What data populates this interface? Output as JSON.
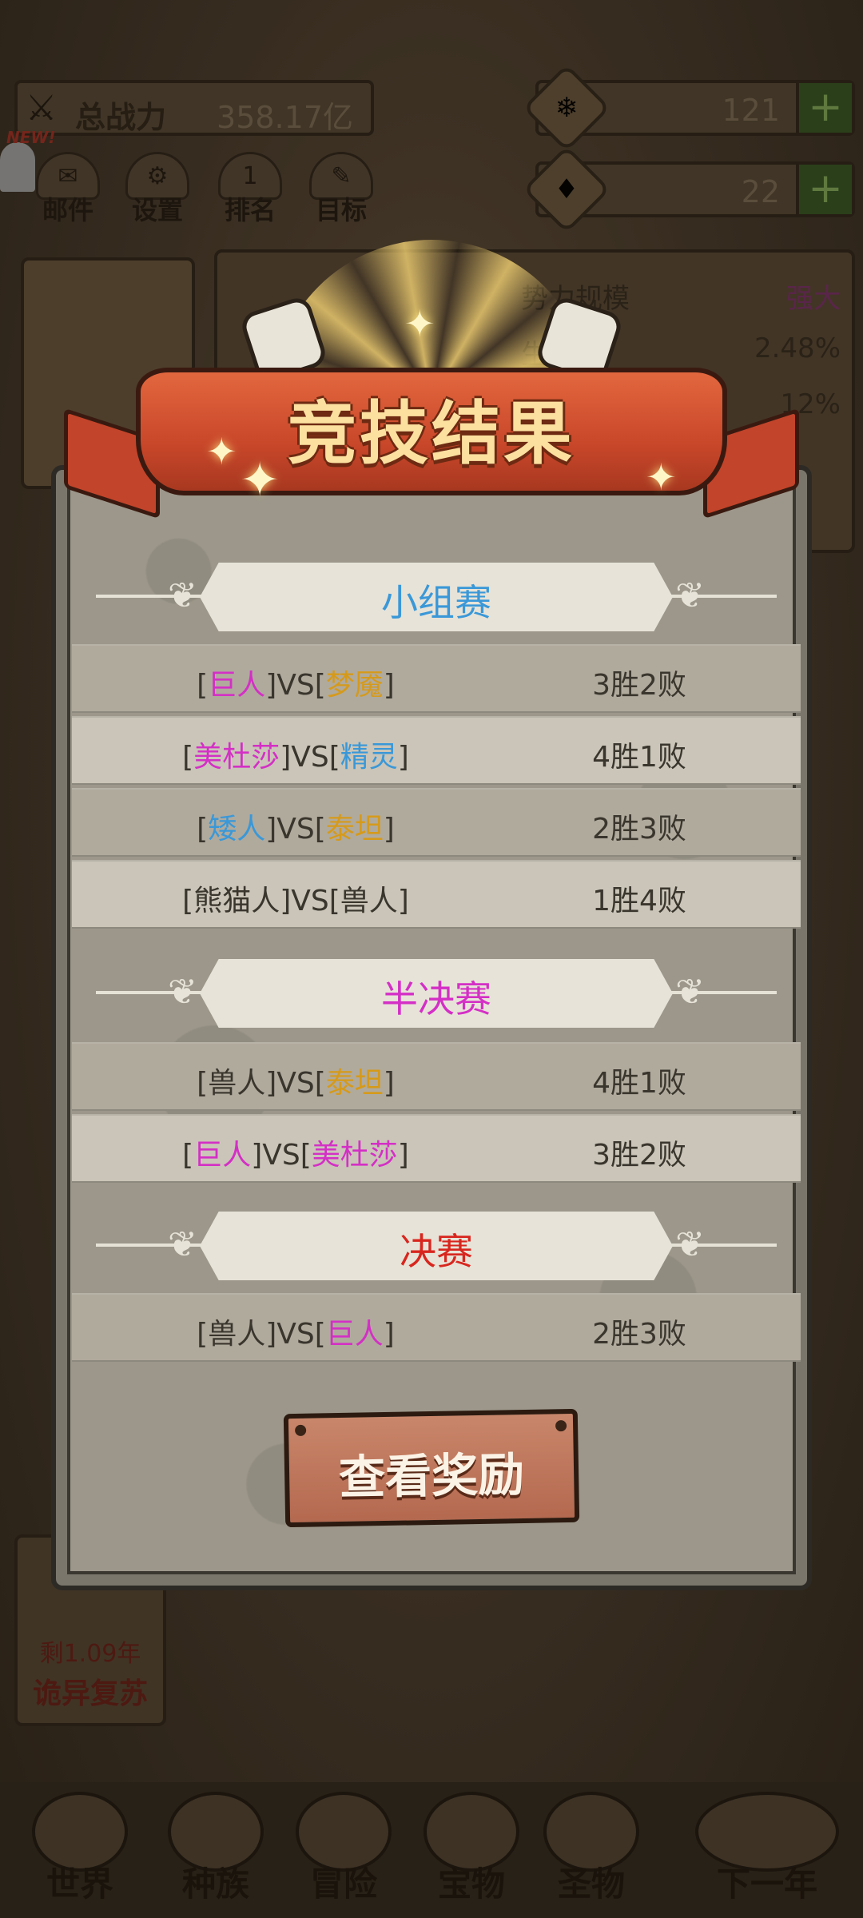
{
  "background": {
    "power_label": "总战力",
    "power_value": "358.17亿",
    "resources": [
      {
        "icon": "snowflake-gem-icon",
        "value": "121"
      },
      {
        "icon": "purple-gem-icon",
        "value": "22"
      }
    ],
    "new_badge": "NEW!",
    "menu": [
      {
        "label": "邮件",
        "icon": "mail-icon"
      },
      {
        "label": "设置",
        "icon": "gear-icon"
      },
      {
        "label": "排名",
        "icon": "ranking-icon"
      },
      {
        "label": "目标",
        "icon": "target-icon"
      }
    ],
    "stats": [
      {
        "label": "势力规模",
        "value": "强大"
      },
      {
        "label": "生率",
        "value": "2.48%"
      },
      {
        "label": "",
        "value": "12%"
      }
    ],
    "event": {
      "remaining": "剩1.09年",
      "name": "诡异复苏"
    },
    "nav": [
      "世界",
      "种族",
      "冒险",
      "宝物",
      "圣物",
      "下一年"
    ]
  },
  "modal": {
    "title": "竞技结果",
    "sections": [
      {
        "title": "小组赛",
        "color": "#3a98d8",
        "matches": [
          {
            "a": "巨人",
            "a_color": "#d42fc6",
            "b": "梦魇",
            "b_color": "#d69a1a",
            "result": "3胜2败"
          },
          {
            "a": "美杜莎",
            "a_color": "#d42fc6",
            "b": "精灵",
            "b_color": "#3a98d8",
            "result": "4胜1败"
          },
          {
            "a": "矮人",
            "a_color": "#3a98d8",
            "b": "泰坦",
            "b_color": "#d69a1a",
            "result": "2胜3败"
          },
          {
            "a": "熊猫人",
            "a_color": "#3a352d",
            "b": "兽人",
            "b_color": "#3a352d",
            "result": "1胜4败"
          }
        ]
      },
      {
        "title": "半决赛",
        "color": "#d42fc6",
        "matches": [
          {
            "a": "兽人",
            "a_color": "#3a352d",
            "b": "泰坦",
            "b_color": "#d69a1a",
            "result": "4胜1败"
          },
          {
            "a": "巨人",
            "a_color": "#d42fc6",
            "b": "美杜莎",
            "b_color": "#d42fc6",
            "result": "3胜2败"
          }
        ]
      },
      {
        "title": "决赛",
        "color": "#d8261e",
        "matches": [
          {
            "a": "兽人",
            "a_color": "#3a352d",
            "b": "巨人",
            "b_color": "#d42fc6",
            "result": "2胜3败"
          }
        ]
      }
    ],
    "vs": "VS",
    "reward_button": "查看奖励"
  }
}
